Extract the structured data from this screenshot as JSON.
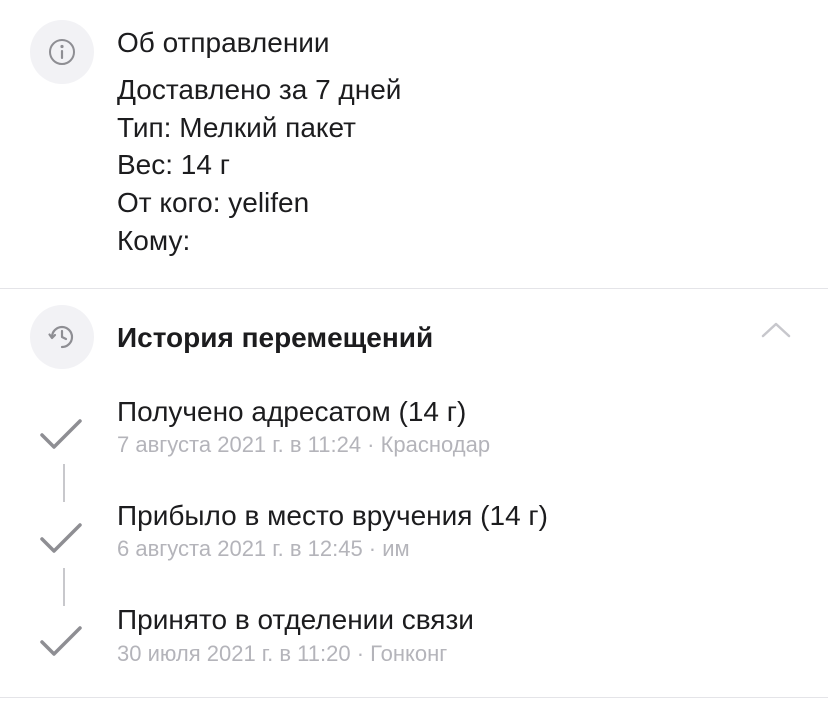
{
  "about": {
    "title": "Об отправлении",
    "lines": [
      "Доставлено за 7 дней",
      "Тип: Мелкий пакет",
      "Вес: 14 г",
      "От кого: yelifen",
      "Кому: "
    ],
    "icon": "info-icon"
  },
  "history": {
    "title": "История перемещений",
    "icon": "clock-history-icon",
    "collapse_icon": "chevron-up-icon",
    "events": [
      {
        "title": "Получено адресатом  (14 г)",
        "meta": "7 августа 2021 г. в 11:24 · Краснодар"
      },
      {
        "title": "Прибыло в место вручения  (14 г)",
        "meta": "6 августа 2021 г. в 12:45 · им"
      },
      {
        "title": "Принято в отделении связи",
        "meta": "30 июля 2021 г. в 11:20 · Гонконг"
      }
    ]
  },
  "colors": {
    "icon_bg": "#f2f2f5",
    "icon_fg": "#8e8e93",
    "check": "#8e8e93",
    "meta": "#b4b4ba"
  }
}
